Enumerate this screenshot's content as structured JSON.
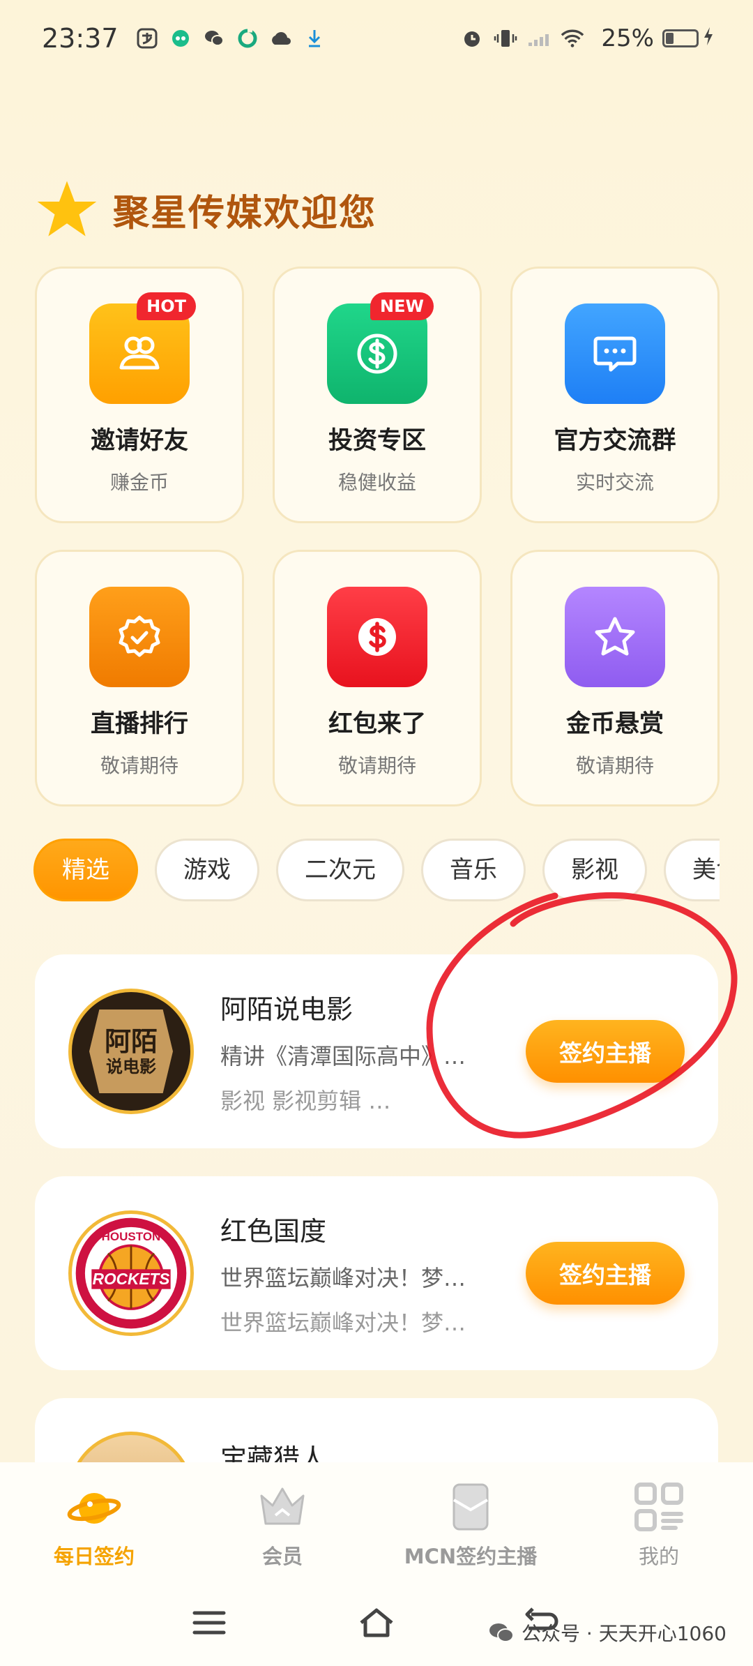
{
  "status_bar": {
    "time": "23:37",
    "battery": "25%"
  },
  "header": {
    "title": "聚星传媒欢迎您"
  },
  "features": [
    {
      "title": "邀请好友",
      "subtitle": "赚金币",
      "badge": "HOT",
      "icon": "users-icon",
      "color": "#ffb000"
    },
    {
      "title": "投资专区",
      "subtitle": "稳健收益",
      "badge": "NEW",
      "icon": "dollar-circle-icon",
      "color": "#14c57b"
    },
    {
      "title": "官方交流群",
      "subtitle": "实时交流",
      "badge": "",
      "icon": "chat-bubble-icon",
      "color": "#2f8ffa"
    },
    {
      "title": "直播排行",
      "subtitle": "敬请期待",
      "badge": "",
      "icon": "verified-badge-icon",
      "color": "#f98b0d"
    },
    {
      "title": "红包来了",
      "subtitle": "敬请期待",
      "badge": "",
      "icon": "dollar-icon",
      "color": "#f3242d"
    },
    {
      "title": "金币悬赏",
      "subtitle": "敬请期待",
      "badge": "",
      "icon": "star-icon",
      "color": "#a170f8"
    }
  ],
  "tabs": [
    "精选",
    "游戏",
    "二次元",
    "音乐",
    "影视",
    "美食"
  ],
  "streamers": [
    {
      "name": "阿陌说电影",
      "line1": "精讲《清潭国际高中》…",
      "line2": "影视 影视剪辑 …",
      "button": "签约主播",
      "avatar_text_1": "阿陌",
      "avatar_text_2": "说电影"
    },
    {
      "name": "红色国度",
      "line1": "世界篮坛巅峰对决！梦…",
      "line2": "世界篮坛巅峰对决！梦…",
      "button": "签约主播",
      "avatar_text_1": "HOUSTON",
      "avatar_text_2": "ROCKETS"
    },
    {
      "name": "宝藏猎人",
      "line1": "",
      "line2": "",
      "button": ""
    }
  ],
  "bottom_nav": [
    {
      "label": "每日签约",
      "icon": "planet-icon",
      "active": true
    },
    {
      "label": "会员",
      "icon": "crown-icon",
      "active": false
    },
    {
      "label": "MCN签约主播",
      "icon": "contract-icon",
      "active": false
    },
    {
      "label": "我的",
      "icon": "grid-profile-icon",
      "active": false
    }
  ],
  "watermark": {
    "text": "公众号 · 天天开心1060"
  },
  "colors": {
    "accent": "#ff9d00",
    "title_brown": "#b0560e",
    "badge_red": "#f0262e",
    "annotation": "#e8101e"
  }
}
